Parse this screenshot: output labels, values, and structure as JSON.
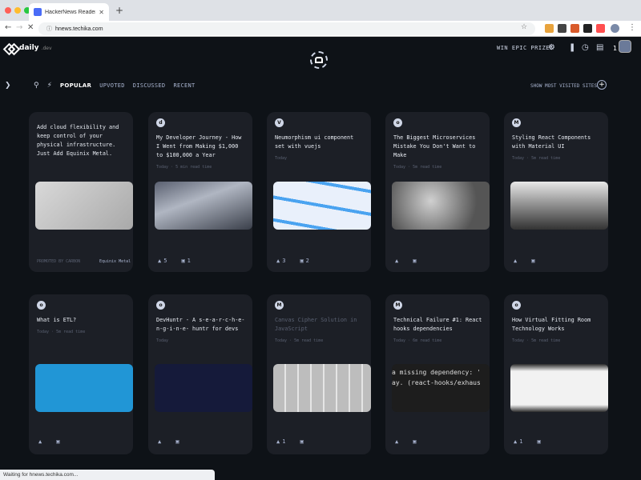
{
  "browser": {
    "tab_title": "HackerNews Reader by Trom",
    "url": "hnews.techika.com",
    "status": "Waiting for hnews.techika.com..."
  },
  "header": {
    "logo_name": "daily",
    "logo_suffix": ".dev",
    "win_text": "WIN EPIC PRIZES",
    "points": "1"
  },
  "filters": {
    "tabs": [
      "POPULAR",
      "UPVOTED",
      "DISCUSSED",
      "RECENT"
    ],
    "show_most": "SHOW MOST VISITED SITES"
  },
  "cards": [
    {
      "title": "Add cloud flexibility and keep control of your physical infrastructure. Just Add Equinix Metal.",
      "meta": "",
      "footer": "PROMOTED BY CARBON",
      "footer2": "Equinix Metal",
      "upvotes": "",
      "comments": "",
      "img": "just-add-metal",
      "src": ""
    },
    {
      "title": "My Developer Journey - How I Went from Making $1,000 to $100,000 a Year",
      "meta": "Today · 5 min read time",
      "upvotes": "5",
      "comments": "1",
      "img": "crowd",
      "src": "d"
    },
    {
      "title": "Neumorphism ui component set with vuejs",
      "meta": "Today",
      "upvotes": "3",
      "comments": "2",
      "img": "vue",
      "src": "V"
    },
    {
      "title": "The Biggest Microservices Mistake You Don't Want to Make",
      "meta": "Today · 5m read time",
      "upvotes": "",
      "comments": "",
      "img": "hand",
      "src": "o"
    },
    {
      "title": "Styling React Components with Material UI",
      "meta": "Today · 5m read time",
      "upvotes": "",
      "comments": "",
      "img": "person",
      "src": "M"
    },
    {
      "title": "What is ETL?",
      "meta": "Today · 5m read time",
      "upvotes": "",
      "comments": "",
      "img": "etl",
      "src": "o"
    },
    {
      "title": "DevHuntr - A s-e-a-r-c-h-e-n-g-i-n-e- huntr for devs",
      "meta": "Today",
      "upvotes": "",
      "comments": "",
      "img": "devhuntr",
      "src": "o"
    },
    {
      "title": "Canvas Cipher Solution in JavaScript",
      "meta": "Today · 5m read time",
      "upvotes": "1",
      "comments": "",
      "img": "cipher",
      "src": "M",
      "dim": true
    },
    {
      "title": "Technical Failure #1: React hooks dependencies",
      "meta": "Today · 6m read time",
      "upvotes": "",
      "comments": "",
      "img": "code",
      "src": "M"
    },
    {
      "title": "How Virtual Fitting Room Technology Works",
      "meta": "Today · 5m read time",
      "upvotes": "1",
      "comments": "",
      "img": "fitting",
      "src": "o"
    }
  ],
  "code_snippet": [
    "a missing dependency: '",
    "ay. (react-hooks/exhaus"
  ]
}
